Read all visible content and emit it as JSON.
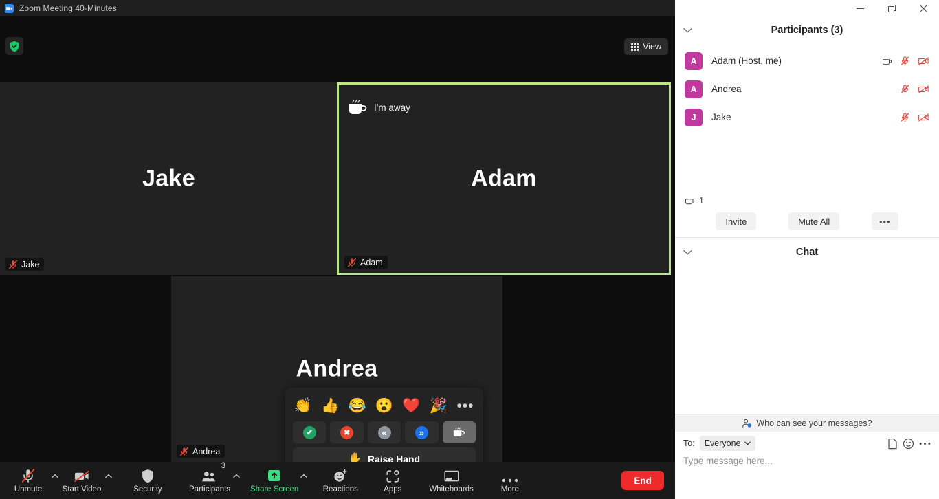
{
  "window": {
    "title": "Zoom Meeting 40-Minutes",
    "logo_icon": "zoom-logo-icon",
    "minimize_icon": "minimize-icon",
    "maximize_icon": "maximize-icon",
    "close_icon": "close-icon"
  },
  "stage": {
    "security_badge_icon": "shield-check-icon",
    "view_button": {
      "label": "View",
      "icon": "grid-view-icon"
    },
    "active_border_color": "#b8e986",
    "away_status": {
      "label": "I'm away",
      "icon": "coffee-cup-icon"
    },
    "tiles": [
      {
        "name": "Jake",
        "big_name": "Jake",
        "muted_icon": "mic-muted-icon",
        "active_speaker": false
      },
      {
        "name": "Adam",
        "big_name": "Adam",
        "muted_icon": "mic-muted-icon",
        "active_speaker": true
      },
      {
        "name": "Andrea",
        "big_name": "Andrea",
        "muted_icon": "mic-muted-icon",
        "active_speaker": false
      }
    ]
  },
  "reactions_popup": {
    "emojis": [
      {
        "glyph": "👏",
        "name": "clap-emoji"
      },
      {
        "glyph": "👍",
        "name": "thumbs-up-emoji"
      },
      {
        "glyph": "😂",
        "name": "joy-emoji"
      },
      {
        "glyph": "😮",
        "name": "open-mouth-emoji"
      },
      {
        "glyph": "❤️",
        "name": "heart-emoji"
      },
      {
        "glyph": "🎉",
        "name": "party-popper-emoji"
      }
    ],
    "more_label": "•••",
    "controls": [
      {
        "name": "yes-button",
        "glyph": "✔",
        "color": "#21a366",
        "active": false
      },
      {
        "name": "no-button",
        "glyph": "✖",
        "color": "#e8452c",
        "active": false
      },
      {
        "name": "slow-down-button",
        "glyph": "«",
        "color": "#8f96a0",
        "active": false
      },
      {
        "name": "speed-up-button",
        "glyph": "»",
        "color": "#1a73e8",
        "active": false
      },
      {
        "name": "away-button",
        "glyph": "☕",
        "color": "",
        "active": true
      }
    ],
    "raise_hand": {
      "label": "Raise Hand",
      "icon": "raised-hand-icon",
      "glyph": "✋"
    }
  },
  "toolbar": {
    "items": [
      {
        "label": "Unmute",
        "icon": "mic-muted-icon",
        "caret": true,
        "state": "muted",
        "badge": ""
      },
      {
        "label": "Start Video",
        "icon": "video-off-icon",
        "caret": true,
        "state": "off",
        "badge": ""
      },
      {
        "label": "Security",
        "icon": "shield-icon",
        "caret": false,
        "state": "",
        "badge": ""
      },
      {
        "label": "Participants",
        "icon": "participants-icon",
        "caret": true,
        "state": "",
        "badge": "3"
      },
      {
        "label": "Share Screen",
        "icon": "share-screen-icon",
        "caret": true,
        "state": "green",
        "badge": ""
      },
      {
        "label": "Reactions",
        "icon": "reactions-icon",
        "caret": false,
        "state": "",
        "badge": ""
      },
      {
        "label": "Apps",
        "icon": "apps-icon",
        "caret": false,
        "state": "",
        "badge": ""
      },
      {
        "label": "Whiteboards",
        "icon": "whiteboard-icon",
        "caret": false,
        "state": "",
        "badge": ""
      },
      {
        "label": "More",
        "icon": "more-dots-icon",
        "caret": false,
        "state": "",
        "badge": ""
      }
    ],
    "end_button": {
      "label": "End",
      "color": "#ee2a2a"
    }
  },
  "participants_panel": {
    "title": "Participants (3)",
    "collapse_icon": "chevron-down-icon",
    "rows": [
      {
        "initial": "A",
        "name": "Adam (Host, me)",
        "away": true,
        "mic_icon": "mic-muted-icon",
        "video_icon": "video-off-icon"
      },
      {
        "initial": "A",
        "name": "Andrea",
        "away": false,
        "mic_icon": "mic-muted-icon",
        "video_icon": "video-off-icon"
      },
      {
        "initial": "J",
        "name": "Jake",
        "away": false,
        "mic_icon": "mic-muted-icon",
        "video_icon": "video-off-icon"
      }
    ],
    "away_summary": {
      "icon": "coffee-cup-icon",
      "count": "1"
    },
    "actions": [
      {
        "label": "Invite",
        "name": "invite-button"
      },
      {
        "label": "Mute All",
        "name": "mute-all-button"
      },
      {
        "label": "•••",
        "name": "participants-more-button"
      }
    ],
    "avatar_color": "#C0399E"
  },
  "chat_panel": {
    "title": "Chat",
    "collapse_icon": "chevron-down-icon",
    "privacy_note": {
      "label": "Who can see your messages?",
      "icon": "person-info-icon"
    },
    "to_label": "To:",
    "to_value": "Everyone",
    "message_placeholder": "Type message here...",
    "icons": [
      {
        "name": "file-attach-icon"
      },
      {
        "name": "emoji-picker-icon"
      },
      {
        "name": "chat-more-icon"
      }
    ]
  }
}
